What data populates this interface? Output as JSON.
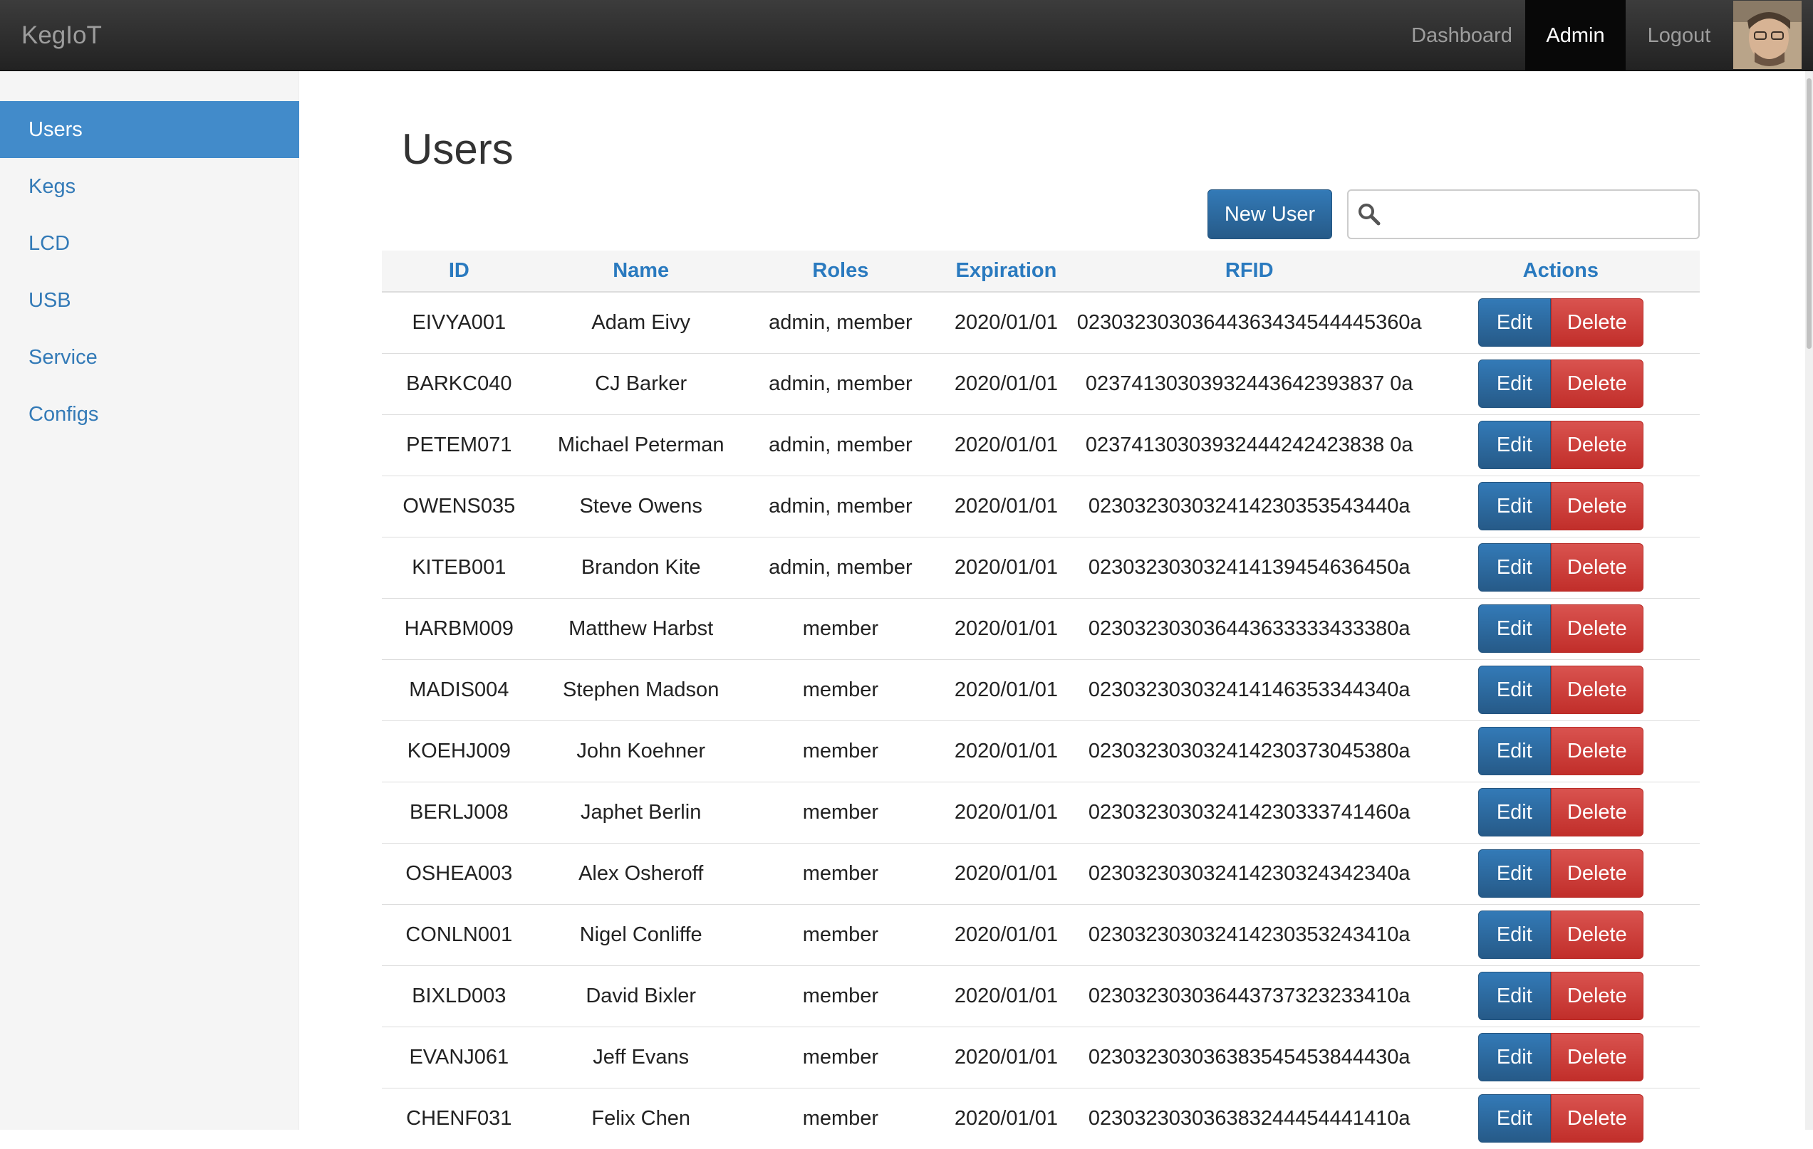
{
  "navbar": {
    "brand": "KegIoT",
    "items": [
      {
        "label": "Dashboard",
        "active": false
      },
      {
        "label": "Admin",
        "active": true
      },
      {
        "label": "Logout",
        "active": false
      }
    ]
  },
  "sidebar": {
    "items": [
      {
        "label": "Users",
        "active": true
      },
      {
        "label": "Kegs",
        "active": false
      },
      {
        "label": "LCD",
        "active": false
      },
      {
        "label": "USB",
        "active": false
      },
      {
        "label": "Service",
        "active": false
      },
      {
        "label": "Configs",
        "active": false
      }
    ]
  },
  "main": {
    "title": "Users",
    "new_user_label": "New User",
    "search": {
      "value": "",
      "placeholder": ""
    },
    "table": {
      "headers": [
        "ID",
        "Name",
        "Roles",
        "Expiration",
        "RFID",
        "Actions"
      ],
      "edit_label": "Edit",
      "delete_label": "Delete",
      "rows": [
        [
          "EIVYA001",
          "Adam Eivy",
          "admin, member",
          "2020/01/01",
          "02303230303644363434544445360a"
        ],
        [
          "BARKC040",
          "CJ Barker",
          "admin, member",
          "2020/01/01",
          "02374130303932443642393837 0a"
        ],
        [
          "PETEM071",
          "Michael Peterman",
          "admin, member",
          "2020/01/01",
          "02374130303932444242423838 0a"
        ],
        [
          "OWENS035",
          "Steve Owens",
          "admin, member",
          "2020/01/01",
          "023032303032414230353543440a"
        ],
        [
          "KITEB001",
          "Brandon Kite",
          "admin, member",
          "2020/01/01",
          "023032303032414139454636450a"
        ],
        [
          "HARBM009",
          "Matthew Harbst",
          "member",
          "2020/01/01",
          "023032303036443633333433380a"
        ],
        [
          "MADIS004",
          "Stephen Madson",
          "member",
          "2020/01/01",
          "023032303032414146353344340a"
        ],
        [
          "KOEHJ009",
          "John Koehner",
          "member",
          "2020/01/01",
          "023032303032414230373045380a"
        ],
        [
          "BERLJ008",
          "Japhet Berlin",
          "member",
          "2020/01/01",
          "023032303032414230333741460a"
        ],
        [
          "OSHEA003",
          "Alex Osheroff",
          "member",
          "2020/01/01",
          "023032303032414230324342340a"
        ],
        [
          "CONLN001",
          "Nigel Conliffe",
          "member",
          "2020/01/01",
          "023032303032414230353243410a"
        ],
        [
          "BIXLD003",
          "David Bixler",
          "member",
          "2020/01/01",
          "023032303036443737323233410a"
        ],
        [
          "EVANJ061",
          "Jeff Evans",
          "member",
          "2020/01/01",
          "023032303036383545453844430a"
        ],
        [
          "CHENF031",
          "Felix Chen",
          "member",
          "2020/01/01",
          "023032303036383244454441410a"
        ]
      ]
    }
  },
  "colors": {
    "primary": "#337ab7",
    "danger": "#d9534f",
    "navbar": "#222222",
    "sidebar_active": "#428bca"
  },
  "icons": {
    "search": "search-icon",
    "avatar": "user-avatar"
  }
}
